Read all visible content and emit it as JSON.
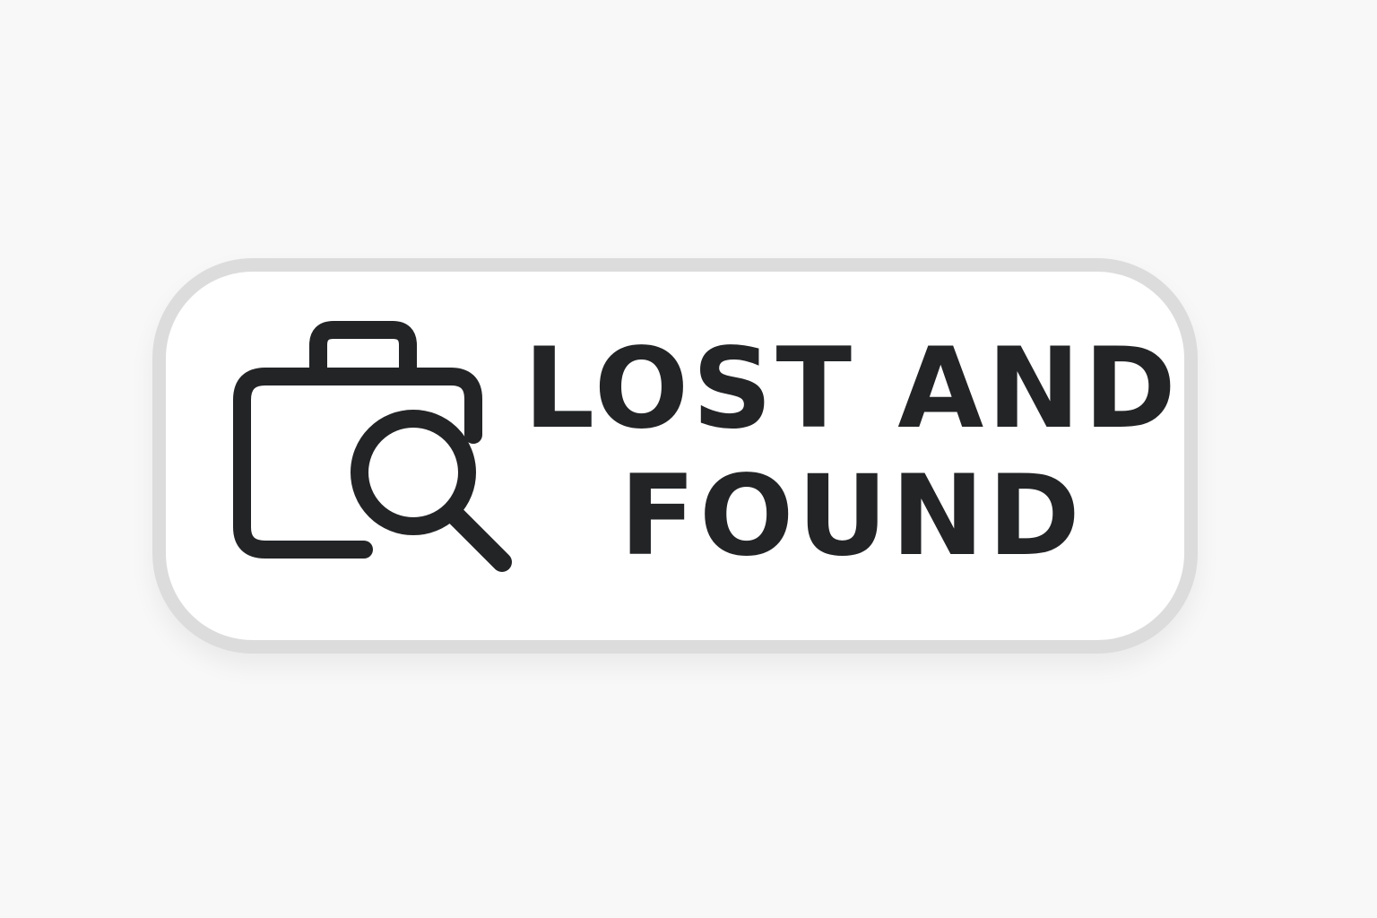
{
  "sign": {
    "line1": "LOST AND",
    "line2": "FOUND",
    "icon": "suitcase-with-magnifier-icon"
  },
  "colors": {
    "background": "#f8f8f8",
    "panel": "#ffffff",
    "border": "#dcdcdc",
    "ink": "#222426"
  }
}
